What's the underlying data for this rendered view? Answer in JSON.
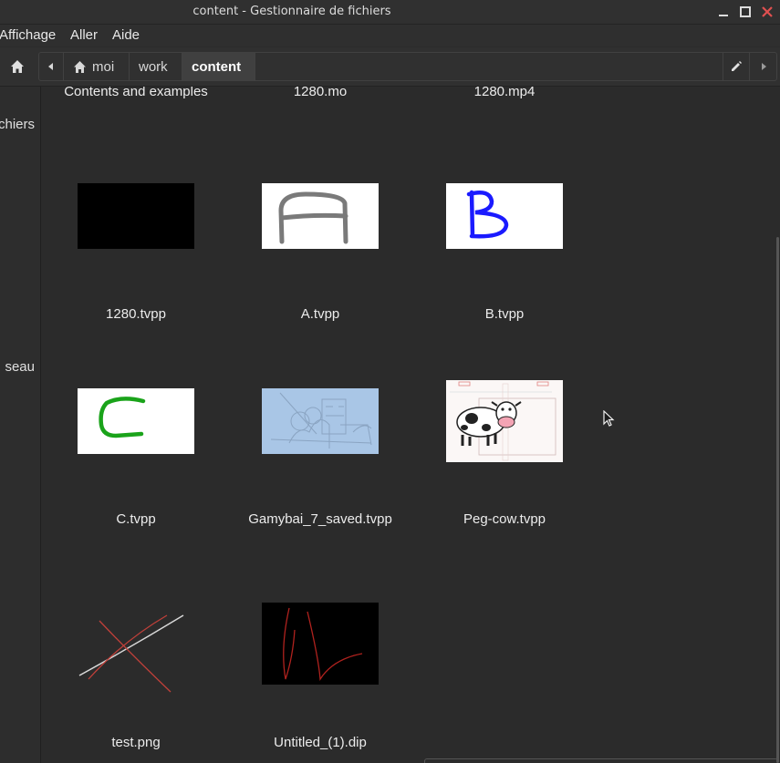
{
  "window": {
    "title": "content - Gestionnaire de fichiers"
  },
  "menu": {
    "items": [
      "Affichage",
      "Aller",
      "Aide"
    ]
  },
  "breadcrumbs": [
    "moi",
    "work",
    "content"
  ],
  "sidebar": {
    "labels": [
      "chiers",
      "seau"
    ]
  },
  "files": {
    "top_row": [
      "Contents and examples",
      "1280.mo",
      "1280.mp4"
    ],
    "row1": [
      "1280.tvpp",
      "A.tvpp",
      "B.tvpp"
    ],
    "row2": [
      "C.tvpp",
      "Gamybai_7_saved.tvpp",
      "Peg-cow.tvpp"
    ],
    "row3": [
      "test.png",
      "Untitled_(1).dip"
    ]
  },
  "colors": {
    "background": "#2b2b2b",
    "accent_b": "#1a1aff",
    "accent_c": "#1aa31a",
    "close": "#e05050"
  },
  "icons": [
    "minimize-icon",
    "maximize-icon",
    "close-icon",
    "home-icon",
    "back-arrow-icon",
    "forward-arrow-icon",
    "edit-pencil-icon"
  ]
}
